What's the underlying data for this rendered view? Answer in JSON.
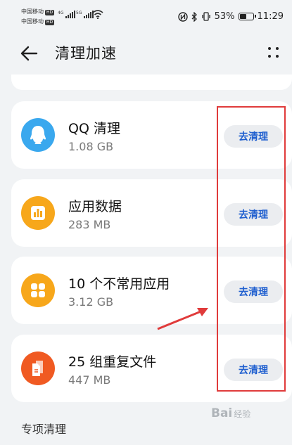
{
  "status_bar": {
    "carrier1": "中国移动",
    "carrier2": "中国移动",
    "hd": "HD",
    "net1": "4G",
    "net2": "5G",
    "battery_percent": "53%",
    "battery_level": 0.53,
    "time": "11:29"
  },
  "header": {
    "title": "清理加速"
  },
  "items": [
    {
      "name": "QQ 清理",
      "size": "1.08 GB",
      "button": "去清理",
      "icon": "qq-icon",
      "color": "#3aa8ee"
    },
    {
      "name": "应用数据",
      "size": "283 MB",
      "button": "去清理",
      "icon": "app-data-icon",
      "color": "#f7a71b"
    },
    {
      "name": "10 个不常用应用",
      "size": "3.12 GB",
      "button": "去清理",
      "icon": "apps-grid-icon",
      "color": "#f7a71b"
    },
    {
      "name": "25 组重复文件",
      "size": "447 MB",
      "button": "去清理",
      "icon": "duplicate-files-icon",
      "color": "#f05a22"
    }
  ],
  "section_title": "专项清理",
  "watermark": {
    "brand": "Bai",
    "suffix": "经验"
  },
  "colors": {
    "annotation": "#e03b3b",
    "button_text": "#1f5fcf"
  }
}
